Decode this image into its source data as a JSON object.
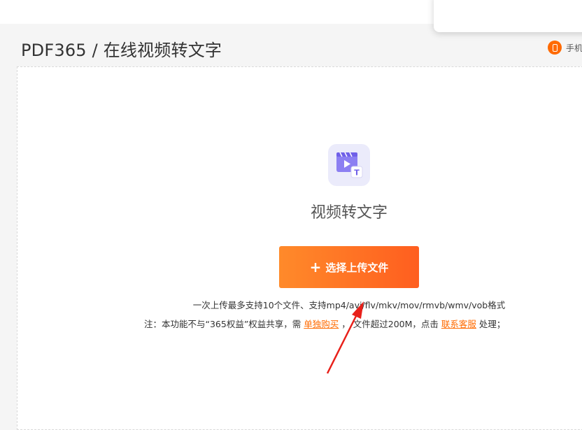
{
  "header": {
    "title": "PDF365 / 在线视频转文字",
    "mobile_label": "手机"
  },
  "tool": {
    "icon": "video-to-text-icon",
    "title": "视频转文字"
  },
  "upload": {
    "button_label": "选择上传文件",
    "formats_text": "一次上传最多支持10个文件、支持mp4/avi/flv/mkv/mov/rmvb/wmv/vob格式"
  },
  "note": {
    "prefix": "注：本功能不与“365权益”权益共享，需",
    "buy_link": "单独购买",
    "middle": "， 文件超过200M，点击",
    "service_link": "联系客服",
    "suffix": "处理；"
  },
  "colors": {
    "accent": "#ff6a00",
    "button_gradient_start": "#ff8a2a",
    "button_gradient_end": "#ff5e1f",
    "icon_bg": "#ebebfb",
    "icon_purple": "#7b6cf0",
    "annotation_arrow": "#e8201a"
  }
}
